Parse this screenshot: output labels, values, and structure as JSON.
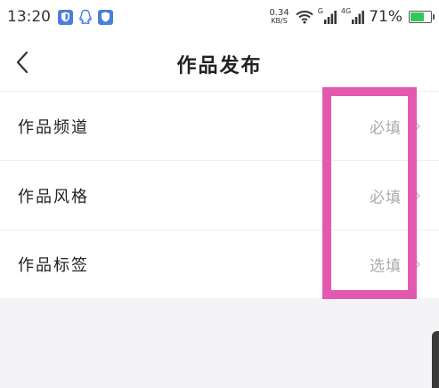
{
  "status_bar": {
    "time": "13:20",
    "net_speed_value": "0.34",
    "net_speed_unit": "KB/S",
    "signal_1_label": "G",
    "signal_2_label": "4G",
    "battery_percent": "71%",
    "battery_level": 0.71
  },
  "nav": {
    "title": "作品发布"
  },
  "form": {
    "rows": [
      {
        "label": "作品频道",
        "value": "必填"
      },
      {
        "label": "作品风格",
        "value": "必填"
      },
      {
        "label": "作品标签",
        "value": "选填"
      }
    ]
  },
  "colors": {
    "highlight": "#e459b0",
    "battery": "#35c65a",
    "shield_blue": "#4a7fdc",
    "muted_text": "#aaaaaa"
  },
  "icons": {
    "back": "chevron-left-icon",
    "row_arrow": "chevron-right-icon"
  }
}
